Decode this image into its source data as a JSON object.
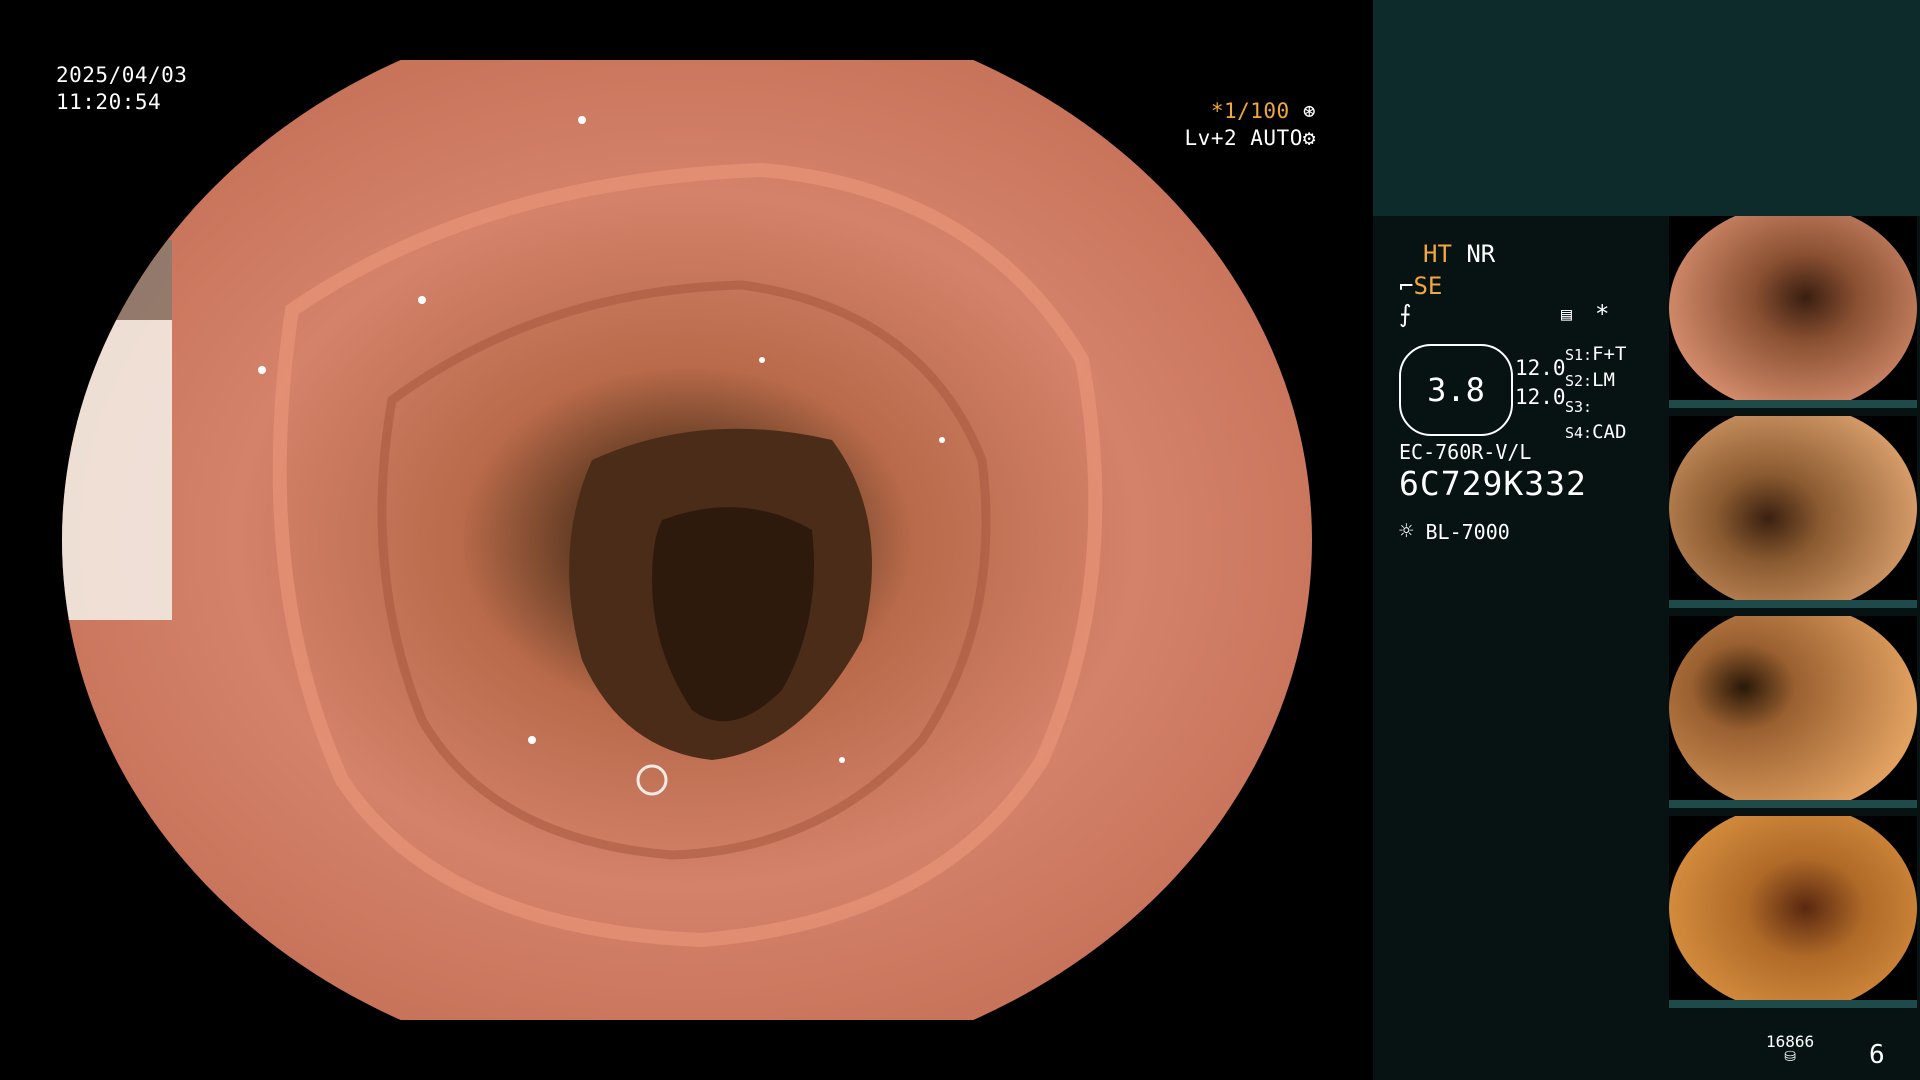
{
  "overlay": {
    "date": "2025/04/03",
    "time": "11:20:54",
    "shutter": "*1/100",
    "level": "Lv+2",
    "mode": "AUTO"
  },
  "panel": {
    "ht": "HT",
    "nr": "NR",
    "se": "SE",
    "star": "*",
    "zoom_value": "3.8",
    "values": [
      "12.0",
      "12.0"
    ],
    "switches": [
      {
        "key": "S1:",
        "value": "F+T"
      },
      {
        "key": "S2:",
        "value": "LM"
      },
      {
        "key": "S3:",
        "value": ""
      },
      {
        "key": "S4:",
        "value": "CAD"
      }
    ],
    "scope_model": "EC-760R-V/L",
    "serial": "6C729K332",
    "light_source": "BL-7000",
    "storage_count": "16866",
    "image_count": "6"
  },
  "colors": {
    "panel_bg": "#071212",
    "panel_top": "#0d2b2b",
    "accent_orange": "#f2a83c"
  },
  "icons": [
    "aperture-icon",
    "gear-icon",
    "scope-icon",
    "signal-icon",
    "menu-icon",
    "lamp-icon",
    "storage-icon"
  ]
}
